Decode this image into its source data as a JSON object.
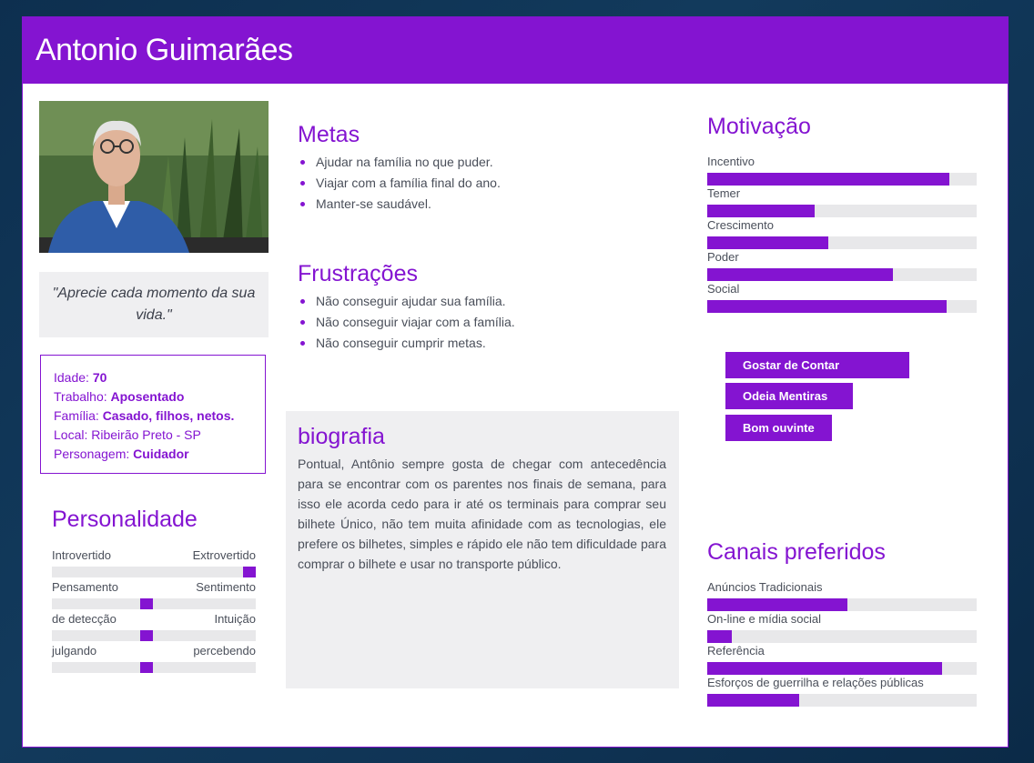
{
  "persona": {
    "name": "Antonio Guimarães",
    "quote": "\"Aprecie cada momento da sua vida.\""
  },
  "facts": [
    {
      "label": "Idade: ",
      "value": "70"
    },
    {
      "label": "Trabalho: ",
      "value": "Aposentado"
    },
    {
      "label": "Família: ",
      "value": "Casado, filhos, netos."
    },
    {
      "label": "Local: Ribeirão Preto - SP",
      "value": ""
    },
    {
      "label": "Personagem: ",
      "value": "Cuidador"
    }
  ],
  "personality": {
    "title": "Personalidade",
    "traits": [
      {
        "left": "Introvertido",
        "right": "Extrovertido",
        "position": 1.0
      },
      {
        "left": "Pensamento",
        "right": "Sentimento",
        "position": 0.46
      },
      {
        "left": "de detecção",
        "right": "Intuição",
        "position": 0.46
      },
      {
        "left": "julgando",
        "right": "percebendo",
        "position": 0.46
      }
    ]
  },
  "goals": {
    "title": "Metas",
    "items": [
      "Ajudar na família no que puder.",
      "Viajar com a família final do ano.",
      "Manter-se saudável."
    ]
  },
  "frustrations": {
    "title": "Frustrações",
    "items": [
      "Não conseguir ajudar sua família.",
      "Não conseguir viajar com a família.",
      "Não conseguir cumprir metas."
    ]
  },
  "biography": {
    "title": "biografia",
    "text": "Pontual, Antônio sempre gosta de chegar com antecedência para se encontrar com os parentes nos finais de semana, para isso ele acorda cedo para ir até os terminais para comprar seu bilhete Único, não tem muita afinidade com as tecnologias, ele prefere os bilhetes, simples e rápido ele não tem dificuldade para comprar o bilhete e usar no transporte público."
  },
  "motivation": {
    "title": "Motivação",
    "items": [
      {
        "label": "Incentivo",
        "value": 0.9
      },
      {
        "label": "Temer",
        "value": 0.4
      },
      {
        "label": "Crescimento",
        "value": 0.45
      },
      {
        "label": "Poder",
        "value": 0.69
      },
      {
        "label": "Social",
        "value": 0.89
      }
    ]
  },
  "tags": [
    "Gostar de Contar Histórias",
    "Odeia Mentiras",
    "Bom ouvinte"
  ],
  "channels": {
    "title": "Canais preferidos",
    "items": [
      {
        "label": "Anúncios Tradicionais",
        "value": 0.52
      },
      {
        "label": "On-line e mídia social",
        "value": 0.09
      },
      {
        "label": "Referência",
        "value": 0.87
      },
      {
        "label": "Esforços de guerrilha e relações públicas",
        "value": 0.34
      }
    ]
  },
  "colors": {
    "accent": "#8414d1",
    "track": "#e8e8ea",
    "panel": "#efeff1"
  }
}
